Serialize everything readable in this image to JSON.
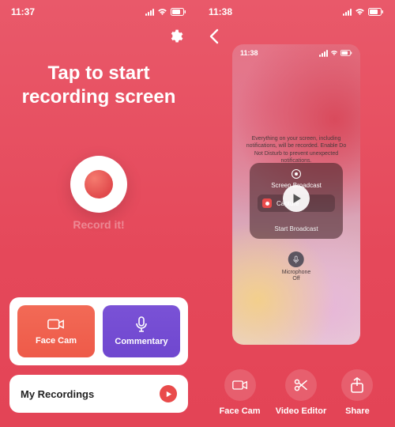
{
  "left": {
    "status_time": "11:37",
    "headline_line1": "Tap to start",
    "headline_line2": "recording screen",
    "watermark": "Record it!",
    "facecam_label": "Face Cam",
    "commentary_label": "Commentary",
    "my_recordings_label": "My Recordings"
  },
  "right": {
    "status_time": "11:38",
    "preview": {
      "status_time": "11:38",
      "message": "Everything on your screen, including notifications, will be recorded. Enable Do Not Disturb to prevent unexpected notifications.",
      "sheet_title": "Screen Broadcast",
      "row_label": "Capture",
      "start_label": "Start Broadcast",
      "mic_label_line1": "Microphone",
      "mic_label_line2": "Off"
    },
    "tools": {
      "facecam": "Face Cam",
      "editor": "Video Editor",
      "share": "Share"
    }
  },
  "colors": {
    "bg": "#e6515f",
    "orange": "#f05c49",
    "purple": "#7049d3",
    "red": "#e94b4b"
  }
}
